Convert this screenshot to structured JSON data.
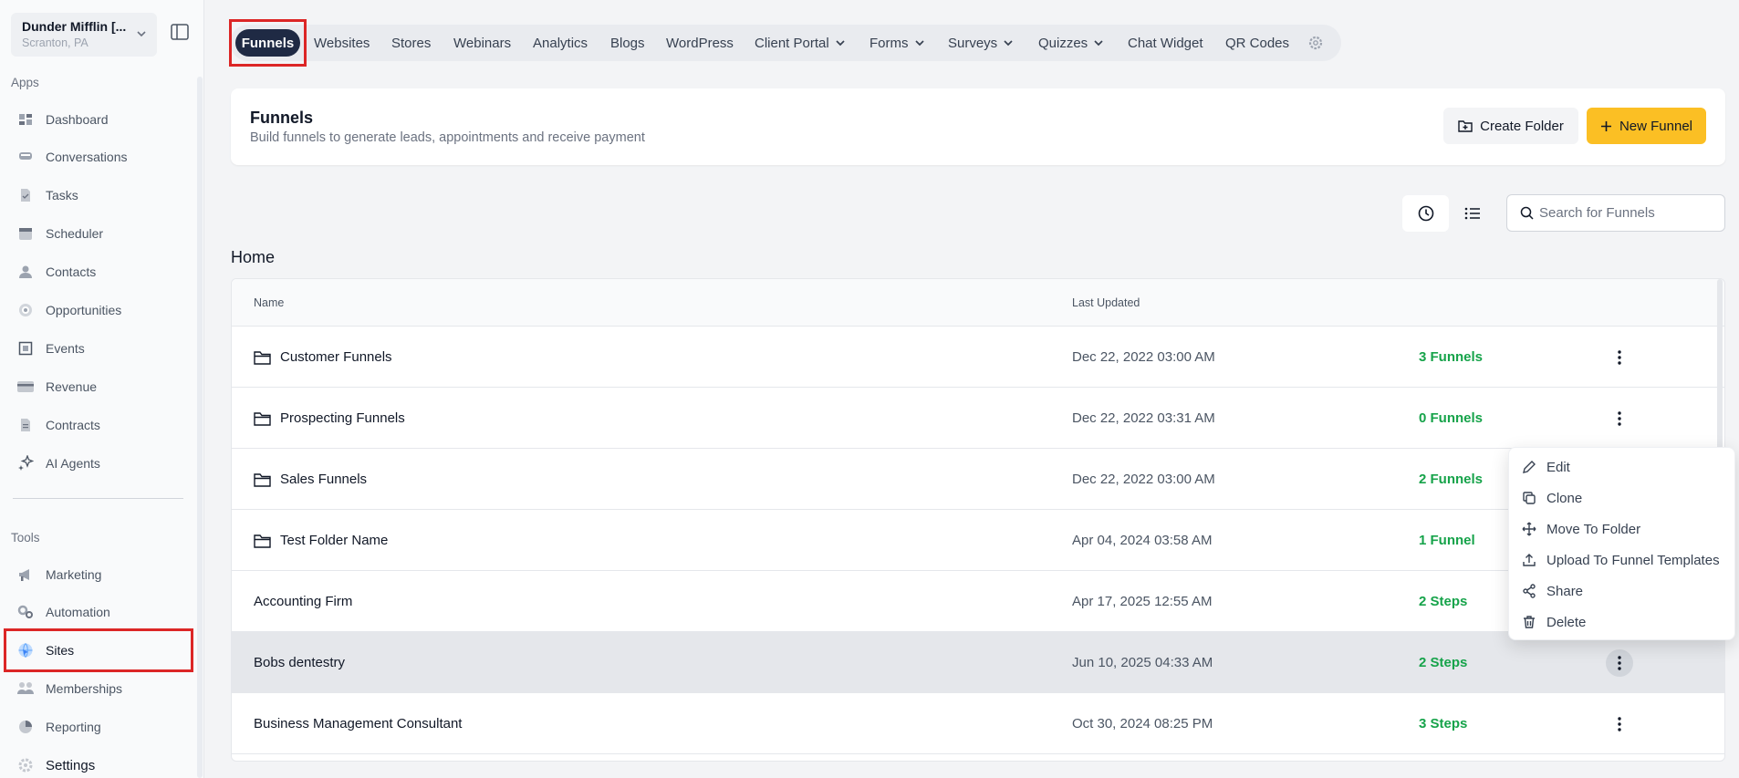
{
  "location": {
    "name": "Dunder Mifflin [...",
    "city": "Scranton, PA"
  },
  "sidebar": {
    "apps_label": "Apps",
    "tools_label": "Tools",
    "apps": [
      {
        "label": "Dashboard",
        "icon": "dashboard-icon"
      },
      {
        "label": "Conversations",
        "icon": "chat-icon"
      },
      {
        "label": "Tasks",
        "icon": "tasks-icon"
      },
      {
        "label": "Scheduler",
        "icon": "calendar-icon"
      },
      {
        "label": "Contacts",
        "icon": "person-icon"
      },
      {
        "label": "Opportunities",
        "icon": "target-icon"
      },
      {
        "label": "Events",
        "icon": "events-icon"
      },
      {
        "label": "Revenue",
        "icon": "card-icon"
      },
      {
        "label": "Contracts",
        "icon": "document-icon"
      },
      {
        "label": "AI Agents",
        "icon": "sparkle-icon"
      }
    ],
    "tools": [
      {
        "label": "Marketing",
        "icon": "megaphone-icon"
      },
      {
        "label": "Automation",
        "icon": "cogs-icon"
      },
      {
        "label": "Sites",
        "icon": "globe-icon"
      },
      {
        "label": "Memberships",
        "icon": "people-icon"
      },
      {
        "label": "Reporting",
        "icon": "pie-icon"
      },
      {
        "label": "Settings",
        "icon": "gear-icon"
      }
    ]
  },
  "topnav": {
    "tabs": [
      "Funnels",
      "Websites",
      "Stores",
      "Webinars",
      "Analytics",
      "Blogs",
      "WordPress",
      "Client Portal",
      "Forms",
      "Surveys",
      "Quizzes",
      "Chat Widget",
      "QR Codes"
    ]
  },
  "header": {
    "title": "Funnels",
    "subtitle": "Build funnels to generate leads, appointments and receive payment",
    "create_folder": "Create Folder",
    "new_funnel": "New Funnel"
  },
  "search": {
    "placeholder": "Search for Funnels"
  },
  "section_title": "Home",
  "table": {
    "columns": [
      "Name",
      "Last Updated"
    ],
    "rows": [
      {
        "name": "Customer Funnels",
        "updated": "Dec 22, 2022 03:00 AM",
        "count": "3 Funnels"
      },
      {
        "name": "Prospecting Funnels",
        "updated": "Dec 22, 2022 03:31 AM",
        "count": "0 Funnels"
      },
      {
        "name": "Sales Funnels",
        "updated": "Dec 22, 2022 03:00 AM",
        "count": "2 Funnels"
      },
      {
        "name": "Test Folder Name",
        "updated": "Apr 04, 2024 03:58 AM",
        "count": "1 Funnel"
      },
      {
        "name": "Accounting Firm",
        "updated": "Apr 17, 2025 12:55 AM",
        "count": "2 Steps"
      },
      {
        "name": "Bobs dentestry",
        "updated": "Jun 10, 2025 04:33 AM",
        "count": "2 Steps"
      },
      {
        "name": "Business Management Consultant",
        "updated": "Oct 30, 2024 08:25 PM",
        "count": "3 Steps"
      }
    ]
  },
  "dropdown": {
    "items": [
      "Edit",
      "Clone",
      "Move To Folder",
      "Upload To Funnel Templates",
      "Share",
      "Delete"
    ]
  },
  "colors": {
    "accent": "#fbbf24",
    "active_tab": "#1f2a44",
    "success": "#16a34a",
    "highlight": "#dc2626"
  }
}
